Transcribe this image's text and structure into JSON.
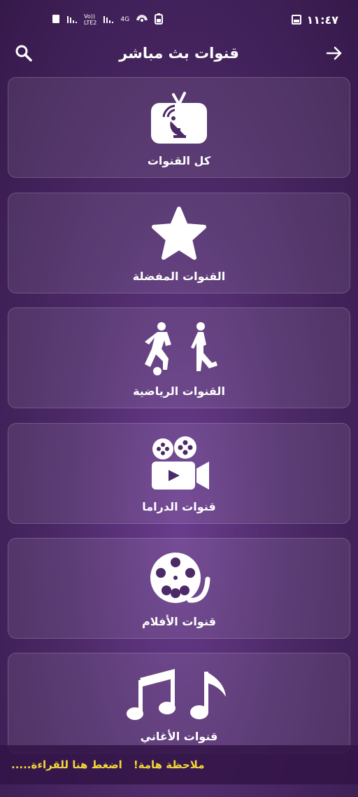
{
  "status": {
    "time": "١١:٤٧",
    "network_label_1": "Vo))\nLTE2",
    "network_label_2": "4G"
  },
  "header": {
    "title": "قنوات بث مباشر"
  },
  "cards": [
    {
      "label": "كل القنوات",
      "icon": "satellite-tv-icon"
    },
    {
      "label": "القنوات المفضلة",
      "icon": "star-icon"
    },
    {
      "label": "القنوات الرياضية",
      "icon": "sports-icon"
    },
    {
      "label": "قنوات الدراما",
      "icon": "movie-camera-icon"
    },
    {
      "label": "قنوات الأفلام",
      "icon": "film-reel-icon"
    },
    {
      "label": "قنوات الأغاني",
      "icon": "music-notes-icon"
    }
  ],
  "notice": {
    "important": "ملاحظة هامة!",
    "read_more": "اضغط هنا للقراءة....."
  },
  "colors": {
    "accent_text": "#f4d83a",
    "background": "#4c2967"
  }
}
